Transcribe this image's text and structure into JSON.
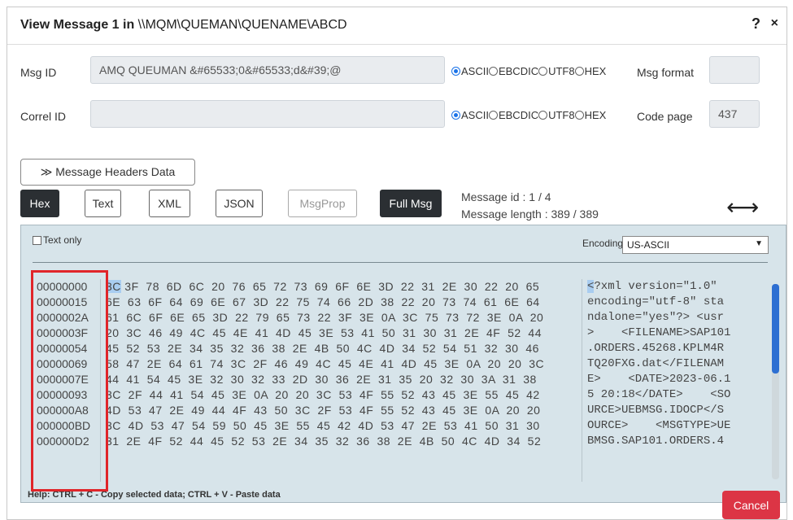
{
  "dialog": {
    "title_prefix": "View Message 1 in ",
    "title_path": "\\\\MQM\\QUEMAN\\QUENAME\\ABCD",
    "help": "?",
    "close": "×"
  },
  "msg_id": {
    "label": "Msg ID",
    "value": "AMQ QUEUMAN  &#65533;0&#65533;d&#39;@",
    "encoding_options": [
      "ASCII",
      "EBCDIC",
      "UTF8",
      "HEX"
    ],
    "selected": "ASCII",
    "format_label": "Msg format",
    "format_value": ""
  },
  "correl_id": {
    "label": "Correl ID",
    "value": "",
    "encoding_options": [
      "ASCII",
      "EBCDIC",
      "UTF8",
      "HEX"
    ],
    "selected": "ASCII",
    "codepage_label": "Code page",
    "codepage_value": "437"
  },
  "headers_button": "≫ Message Headers Data",
  "view_buttons": {
    "hex": "Hex",
    "text": "Text",
    "xml": "XML",
    "json": "JSON",
    "msgprop": "MsgProp",
    "fullmsg": "Full Msg"
  },
  "message_info": {
    "id": "Message id : 1 / 4",
    "length": "Message length : 389 / 389"
  },
  "panel": {
    "text_only": "Text only",
    "encoding_label": "Encoding:",
    "encoding_value": "US-ASCII"
  },
  "dump": {
    "offsets": [
      "00000000",
      "00000015",
      "0000002A",
      "0000003F",
      "00000054",
      "00000069",
      "0000007E",
      "00000093",
      "000000A8",
      "000000BD",
      "000000D2"
    ],
    "hex_first": "3C",
    "hex_rows": [
      " 3F  78  6D  6C  20  76  65  72  73  69  6F  6E  3D  22  31  2E  30  22  20  65",
      "6E  63  6F  64  69  6E  67  3D  22  75  74  66  2D  38  22  20  73  74  61  6E  64",
      "61  6C  6F  6E  65  3D  22  79  65  73  22  3F  3E  0A  3C  75  73  72  3E  0A  20",
      "20  3C  46  49  4C  45  4E  41  4D  45  3E  53  41  50  31  30  31  2E  4F  52  44",
      "45  52  53  2E  34  35  32  36  38  2E  4B  50  4C  4D  34  52  54  51  32  30  46",
      "58  47  2E  64  61  74  3C  2F  46  49  4C  45  4E  41  4D  45  3E  0A  20  20  3C",
      "44  41  54  45  3E  32  30  32  33  2D  30  36  2E  31  35  20  32  30  3A  31  38",
      "3C  2F  44  41  54  45  3E  0A  20  20  3C  53  4F  55  52  43  45  3E  55  45  42",
      "4D  53  47  2E  49  44  4F  43  50  3C  2F  53  4F  55  52  43  45  3E  0A  20  20",
      "3C  4D  53  47  54  59  50  45  3E  55  45  42  4D  53  47  2E  53  41  50  31  30",
      "31  2E  4F  52  44  45  52  53  2E  34  35  32  36  38  2E  4B  50  4C  4D  34  52"
    ],
    "ascii_first": "<",
    "ascii_rows": [
      "?xml version=\"1.0\"",
      "encoding=\"utf-8\" sta",
      "ndalone=\"yes\"?> <usr",
      ">    <FILENAME>SAP101",
      ".ORDERS.45268.KPLM4R",
      "TQ20FXG.dat</FILENAM",
      "E>    <DATE>2023-06.1",
      "5 20:18</DATE>    <SO",
      "URCE>UEBMSG.IDOCP</S",
      "OURCE>    <MSGTYPE>UE",
      "BMSG.SAP101.ORDERS.4"
    ]
  },
  "help_text": "Help: CTRL + C - Copy selected data; CTRL + V - Paste data",
  "cancel_button": "Cancel"
}
